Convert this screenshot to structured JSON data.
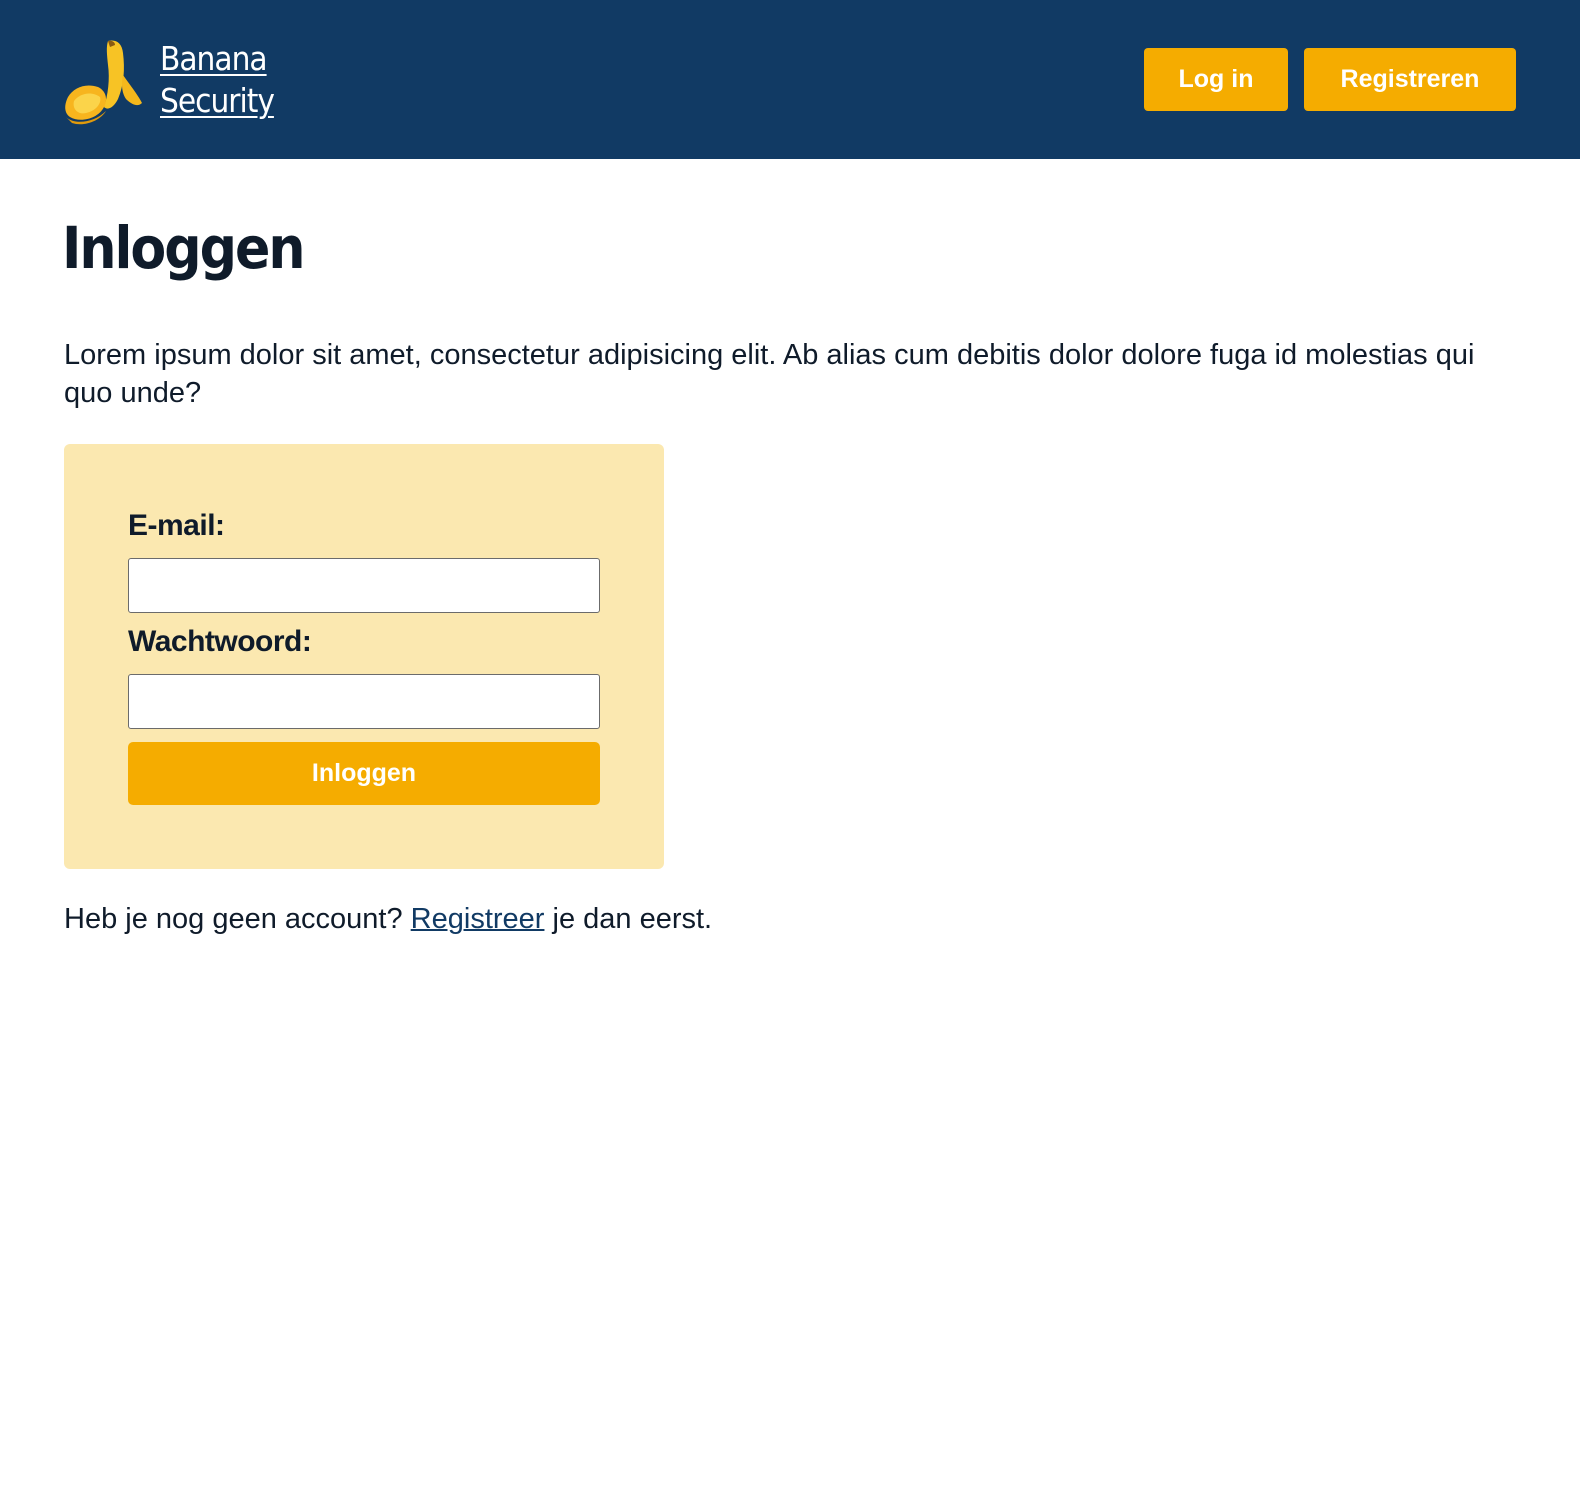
{
  "header": {
    "brand_line1": "Banana",
    "brand_line2": "Security",
    "logo_icon": "banana-icon",
    "login_label": "Log in",
    "register_label": "Registreren"
  },
  "main": {
    "title": "Inloggen",
    "intro": "Lorem ipsum dolor sit amet, consectetur adipisicing elit. Ab alias cum debitis dolor dolore fuga id molestias qui quo unde?"
  },
  "form": {
    "email_label": "E-mail:",
    "email_value": "",
    "password_label": "Wachtwoord:",
    "password_value": "",
    "submit_label": "Inloggen"
  },
  "footer": {
    "prefix": "Heb je nog geen account?",
    "link_label": "Registreer",
    "suffix": "je dan eerst."
  },
  "colors": {
    "header_bg": "#113a64",
    "accent": "#f5ac00",
    "form_bg": "#fbe8b0",
    "text": "#0f1b2a"
  }
}
